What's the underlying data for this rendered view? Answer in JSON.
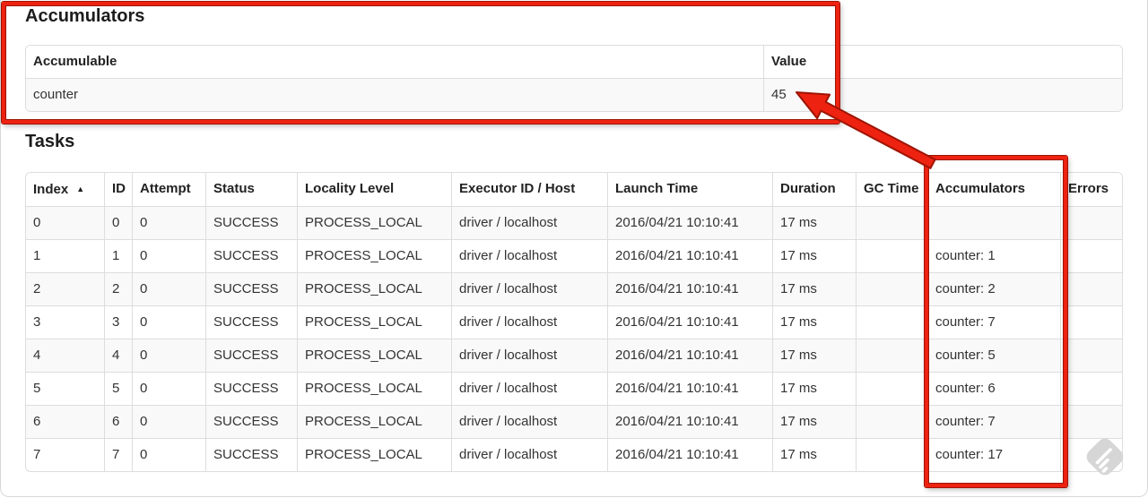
{
  "accumulators_section": {
    "title": "Accumulators",
    "table": {
      "headers": [
        "Accumulable",
        "Value"
      ],
      "rows": [
        [
          "counter",
          "45"
        ]
      ]
    }
  },
  "tasks_section": {
    "title": "Tasks",
    "table": {
      "headers": [
        "Index",
        "ID",
        "Attempt",
        "Status",
        "Locality Level",
        "Executor ID / Host",
        "Launch Time",
        "Duration",
        "GC Time",
        "Accumulators",
        "Errors"
      ],
      "sort": {
        "column": "Index",
        "indicator": "▲"
      },
      "rows": [
        [
          "0",
          "0",
          "0",
          "SUCCESS",
          "PROCESS_LOCAL",
          "driver / localhost",
          "2016/04/21 10:10:41",
          "17 ms",
          "",
          "",
          ""
        ],
        [
          "1",
          "1",
          "0",
          "SUCCESS",
          "PROCESS_LOCAL",
          "driver / localhost",
          "2016/04/21 10:10:41",
          "17 ms",
          "",
          "counter: 1",
          ""
        ],
        [
          "2",
          "2",
          "0",
          "SUCCESS",
          "PROCESS_LOCAL",
          "driver / localhost",
          "2016/04/21 10:10:41",
          "17 ms",
          "",
          "counter: 2",
          ""
        ],
        [
          "3",
          "3",
          "0",
          "SUCCESS",
          "PROCESS_LOCAL",
          "driver / localhost",
          "2016/04/21 10:10:41",
          "17 ms",
          "",
          "counter: 7",
          ""
        ],
        [
          "4",
          "4",
          "0",
          "SUCCESS",
          "PROCESS_LOCAL",
          "driver / localhost",
          "2016/04/21 10:10:41",
          "17 ms",
          "",
          "counter: 5",
          ""
        ],
        [
          "5",
          "5",
          "0",
          "SUCCESS",
          "PROCESS_LOCAL",
          "driver / localhost",
          "2016/04/21 10:10:41",
          "17 ms",
          "",
          "counter: 6",
          ""
        ],
        [
          "6",
          "6",
          "0",
          "SUCCESS",
          "PROCESS_LOCAL",
          "driver / localhost",
          "2016/04/21 10:10:41",
          "17 ms",
          "",
          "counter: 7",
          ""
        ],
        [
          "7",
          "7",
          "0",
          "SUCCESS",
          "PROCESS_LOCAL",
          "driver / localhost",
          "2016/04/21 10:10:41",
          "17 ms",
          "",
          "counter: 17",
          ""
        ]
      ]
    }
  },
  "annotations": {
    "highlight_color": "#ee2211"
  },
  "watermark": {
    "icon": "diamond-logo"
  }
}
